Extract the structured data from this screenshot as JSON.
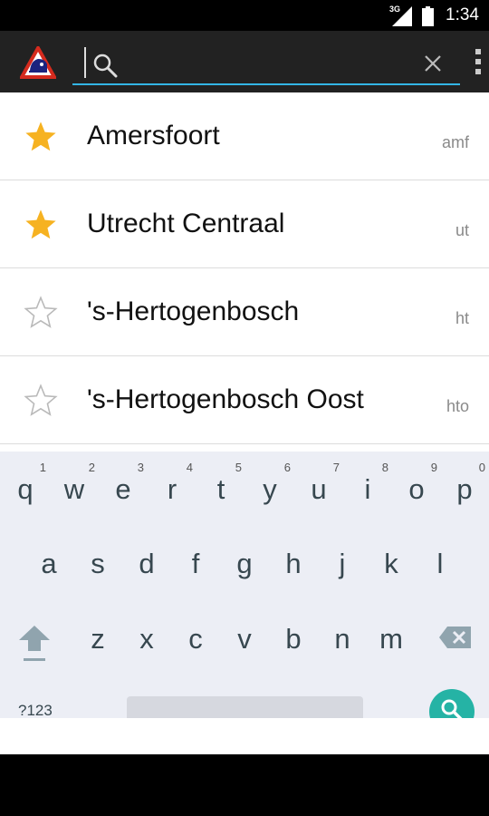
{
  "status_bar": {
    "network": "3G",
    "time": "1:34",
    "icons": [
      "signal-icon",
      "battery-icon"
    ]
  },
  "action_bar": {
    "logo": "train-logo-icon",
    "search": {
      "value": "",
      "placeholder": ""
    },
    "icons": [
      "search-icon",
      "clear-icon",
      "overflow-menu-icon"
    ],
    "accent_color": "#33b5e5"
  },
  "stations": [
    {
      "name": "Amersfoort",
      "code": "amf",
      "favorite": true
    },
    {
      "name": "Utrecht Centraal",
      "code": "ut",
      "favorite": true
    },
    {
      "name": "'s-Hertogenbosch",
      "code": "ht",
      "favorite": false
    },
    {
      "name": "'s-Hertogenbosch Oost",
      "code": "hto",
      "favorite": false
    }
  ],
  "colors": {
    "star_filled": "#f6b221",
    "star_outline": "#b9b9b9",
    "keyboard_bg": "#eceef5",
    "action_key": "#25b3a5"
  },
  "keyboard": {
    "row1": [
      {
        "key": "q",
        "hint": "1"
      },
      {
        "key": "w",
        "hint": "2"
      },
      {
        "key": "e",
        "hint": "3"
      },
      {
        "key": "r",
        "hint": "4"
      },
      {
        "key": "t",
        "hint": "5"
      },
      {
        "key": "y",
        "hint": "6"
      },
      {
        "key": "u",
        "hint": "7"
      },
      {
        "key": "i",
        "hint": "8"
      },
      {
        "key": "o",
        "hint": "9"
      },
      {
        "key": "p",
        "hint": "0"
      }
    ],
    "row2": [
      "a",
      "s",
      "d",
      "f",
      "g",
      "h",
      "j",
      "k",
      "l"
    ],
    "row3": [
      "z",
      "x",
      "c",
      "v",
      "b",
      "n",
      "m"
    ],
    "mode_label": "?123",
    "icons": [
      "shift-icon",
      "delete-icon",
      "search-action-icon"
    ]
  }
}
